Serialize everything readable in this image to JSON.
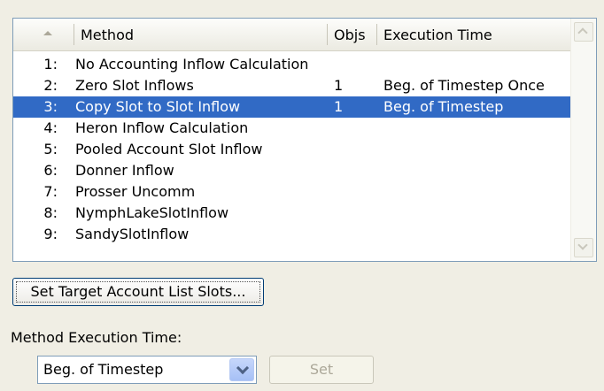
{
  "list": {
    "columns": {
      "method": "Method",
      "objs": "Objs",
      "time": "Execution Time"
    },
    "rows": [
      {
        "num": "1:",
        "method": "No Accounting Inflow Calculation",
        "objs": "",
        "time": ""
      },
      {
        "num": "2:",
        "method": "Zero Slot Inflows",
        "objs": "1",
        "time": "Beg. of Timestep Once"
      },
      {
        "num": "3:",
        "method": "Copy Slot to Slot Inflow",
        "objs": "1",
        "time": "Beg. of Timestep"
      },
      {
        "num": "4:",
        "method": "Heron Inflow Calculation",
        "objs": "",
        "time": ""
      },
      {
        "num": "5:",
        "method": "Pooled Account Slot Inflow",
        "objs": "",
        "time": ""
      },
      {
        "num": "6:",
        "method": "Donner Inflow",
        "objs": "",
        "time": ""
      },
      {
        "num": "7:",
        "method": "Prosser Uncomm",
        "objs": "",
        "time": ""
      },
      {
        "num": "8:",
        "method": "NymphLakeSlotInflow",
        "objs": "",
        "time": ""
      },
      {
        "num": "9:",
        "method": "SandySlotInflow",
        "objs": "",
        "time": ""
      }
    ],
    "selected_index": 2,
    "sort_icon": "sort-ascending-icon"
  },
  "buttons": {
    "set_target": "Set Target Account List Slots...",
    "set": "Set"
  },
  "exec_time": {
    "label": "Method Execution Time:",
    "selected": "Beg. of Timestep"
  },
  "colors": {
    "selection": "#316ac5",
    "background": "#f0eee4"
  }
}
